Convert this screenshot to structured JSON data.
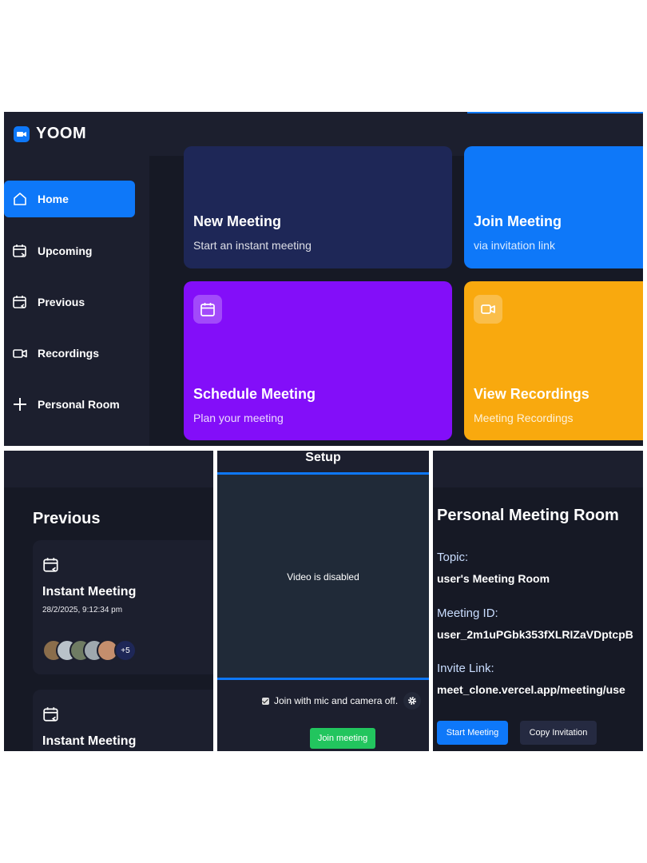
{
  "brand": {
    "name": "YOOM"
  },
  "sidebar": {
    "items": [
      {
        "label": "Home",
        "icon": "home-icon"
      },
      {
        "label": "Upcoming",
        "icon": "calendar-upcoming-icon"
      },
      {
        "label": "Previous",
        "icon": "calendar-previous-icon"
      },
      {
        "label": "Recordings",
        "icon": "video-icon"
      },
      {
        "label": "Personal Room",
        "icon": "plus-icon"
      }
    ]
  },
  "cards": [
    {
      "title": "New Meeting",
      "subtitle": "Start an instant meeting",
      "color": "#1e2757"
    },
    {
      "title": "Join Meeting",
      "subtitle": "via invitation link",
      "color": "#0e78f9"
    },
    {
      "title": "Schedule Meeting",
      "subtitle": "Plan your meeting",
      "color": "#830ef9",
      "icon": "calendar-icon"
    },
    {
      "title": "View Recordings",
      "subtitle": "Meeting Recordings",
      "color": "#f9a90e",
      "icon": "video-icon"
    }
  ],
  "previous": {
    "heading": "Previous",
    "meetings": [
      {
        "title": "Instant Meeting",
        "datetime": "28/2/2025, 9:12:34 pm",
        "extra_count": "+5"
      },
      {
        "title": "Instant Meeting"
      }
    ]
  },
  "setup": {
    "title": "Setup",
    "video_status": "Video is disabled",
    "checkbox_label": "Join with mic and camera off.",
    "join_button": "Join meeting"
  },
  "personal_room": {
    "heading": "Personal Meeting Room",
    "topic_label": "Topic:",
    "topic_value": "user's Meeting Room",
    "id_label": "Meeting ID:",
    "id_value": "user_2m1uPGbk353fXLRIZaVDptcpB",
    "link_label": "Invite Link:",
    "link_value": "meet_clone.vercel.app/meeting/use",
    "start_button": "Start Meeting",
    "copy_button": "Copy Invitation"
  },
  "colors": {
    "accent": "#0e78f9",
    "background": "#161925",
    "surface": "#1c1f2e",
    "join_green": "#22c55e"
  }
}
